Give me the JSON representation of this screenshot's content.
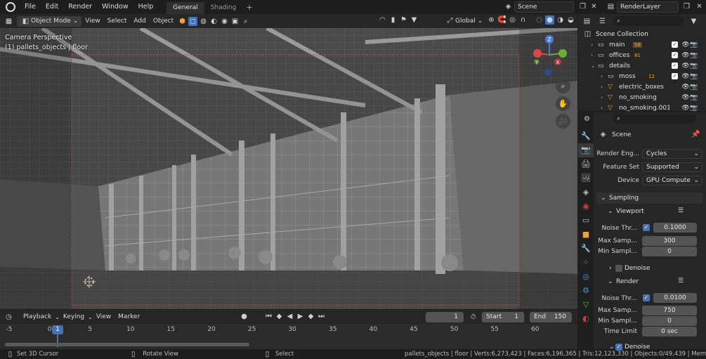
{
  "topbar": {
    "menus": [
      "File",
      "Edit",
      "Render",
      "Window",
      "Help"
    ],
    "workspaces": [
      "General",
      "Shading"
    ],
    "active_workspace": "General",
    "scene": "Scene",
    "view_layer": "RenderLayer"
  },
  "viewport_header": {
    "mode": "Object Mode",
    "menus": [
      "View",
      "Select",
      "Add",
      "Object"
    ],
    "orientation": "Global"
  },
  "viewport": {
    "camera_label": "Camera Perspective",
    "object_label": "(1) pallets_objects | floor"
  },
  "timeline": {
    "menus": [
      "Playback",
      "Keying",
      "View",
      "Marker"
    ],
    "current_frame": "1",
    "start_label": "Start",
    "start": "1",
    "end_label": "End",
    "end": "150",
    "ticks": [
      "-5",
      "0",
      "5",
      "10",
      "15",
      "20",
      "25",
      "30",
      "35",
      "40",
      "45",
      "50",
      "55",
      "60"
    ],
    "playhead_label": "1"
  },
  "statusbar": {
    "set_cursor": "Set 3D Cursor",
    "rotate": "Rotate View",
    "select": "Select",
    "stats": "pallets_objects | floor | Verts:6,273,423 | Faces:6,196,365 | Tris:12,123,330 | Objects:0/49,439 | Mem"
  },
  "outliner": {
    "root": "Scene Collection",
    "items": [
      {
        "name": "main",
        "badge": "58"
      },
      {
        "name": "offices",
        "badge": "81"
      },
      {
        "name": "details",
        "badge": ""
      },
      {
        "name": "moss",
        "badge": "12"
      },
      {
        "name": "electric_boxes",
        "badge": ""
      },
      {
        "name": "no_smoking",
        "badge": ""
      },
      {
        "name": "no_smoking.001",
        "badge": ""
      }
    ]
  },
  "properties": {
    "context": "Scene",
    "render_engine_label": "Render Eng...",
    "render_engine": "Cycles",
    "feature_set_label": "Feature Set",
    "feature_set": "Supported",
    "device_label": "Device",
    "device": "GPU Compute",
    "sampling": "Sampling",
    "viewport": "Viewport",
    "vp_noise_label": "Noise Thr...",
    "vp_noise": "0.1000",
    "vp_max_label": "Max Samp...",
    "vp_max": "300",
    "vp_min_label": "Min Sampl...",
    "vp_min": "0",
    "denoise": "Denoise",
    "render": "Render",
    "r_noise_label": "Noise Thr...",
    "r_noise": "0.0100",
    "r_max_label": "Max Samp...",
    "r_max": "750",
    "r_min_label": "Min Sampl...",
    "r_min": "0",
    "time_limit_label": "Time Limit",
    "time_limit": "0 sec",
    "denoise2": "Denoise"
  }
}
